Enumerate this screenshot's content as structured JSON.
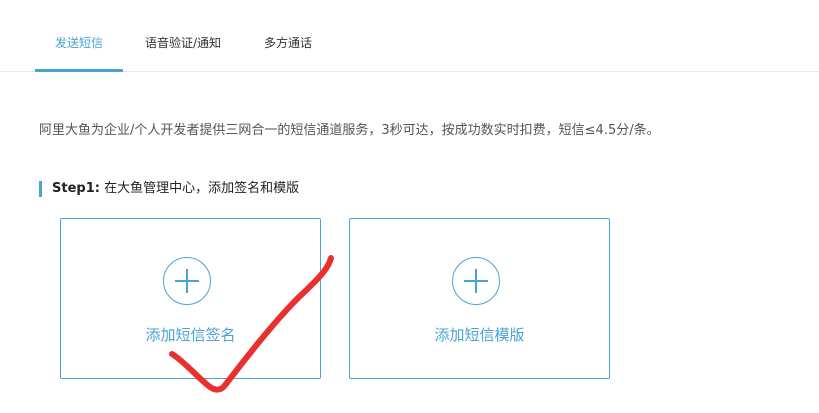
{
  "tabs": [
    {
      "label": "发送短信",
      "active": true
    },
    {
      "label": "语音验证/通知",
      "active": false
    },
    {
      "label": "多方通话",
      "active": false
    }
  ],
  "description": "阿里大鱼为企业/个人开发者提供三网合一的短信通道服务，3秒可达，按成功数实时扣费，短信≤4.5分/条。",
  "step1": {
    "label": "Step1:",
    "text": " 在大鱼管理中心，添加签名和模版"
  },
  "cards": [
    {
      "label": "添加短信签名",
      "icon": "plus-circle-icon"
    },
    {
      "label": "添加短信模版",
      "icon": "plus-circle-icon"
    }
  ],
  "colors": {
    "accent": "#4aa3d3",
    "annotation": "#e8312f"
  }
}
